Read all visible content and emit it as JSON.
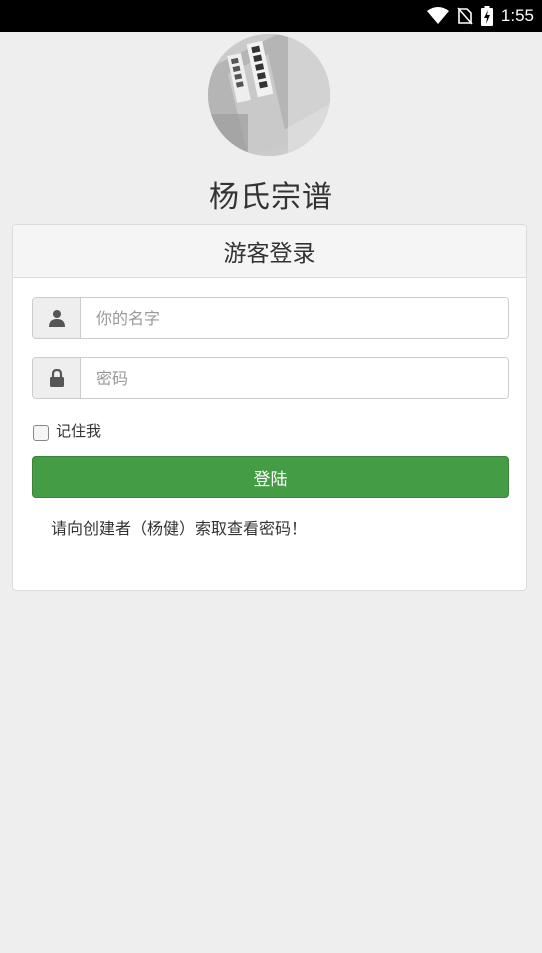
{
  "status_bar": {
    "time": "1:55",
    "icons": [
      "wifi-icon",
      "no-sim-icon",
      "battery-charging-icon"
    ]
  },
  "app": {
    "title": "杨氏宗谱",
    "avatar": "book-cover-photo"
  },
  "login_panel": {
    "heading": "游客登录",
    "username": {
      "placeholder": "你的名字",
      "value": "",
      "icon": "user-icon"
    },
    "password": {
      "placeholder": "密码",
      "value": "",
      "icon": "lock-icon"
    },
    "remember_label": "记住我",
    "remember_checked": false,
    "submit_label": "登陆",
    "notice": "请向创建者（杨健）索取查看密码！"
  },
  "colors": {
    "background": "#eeeeee",
    "primary_button": "#449d44",
    "panel_heading_bg": "#f5f5f5"
  }
}
